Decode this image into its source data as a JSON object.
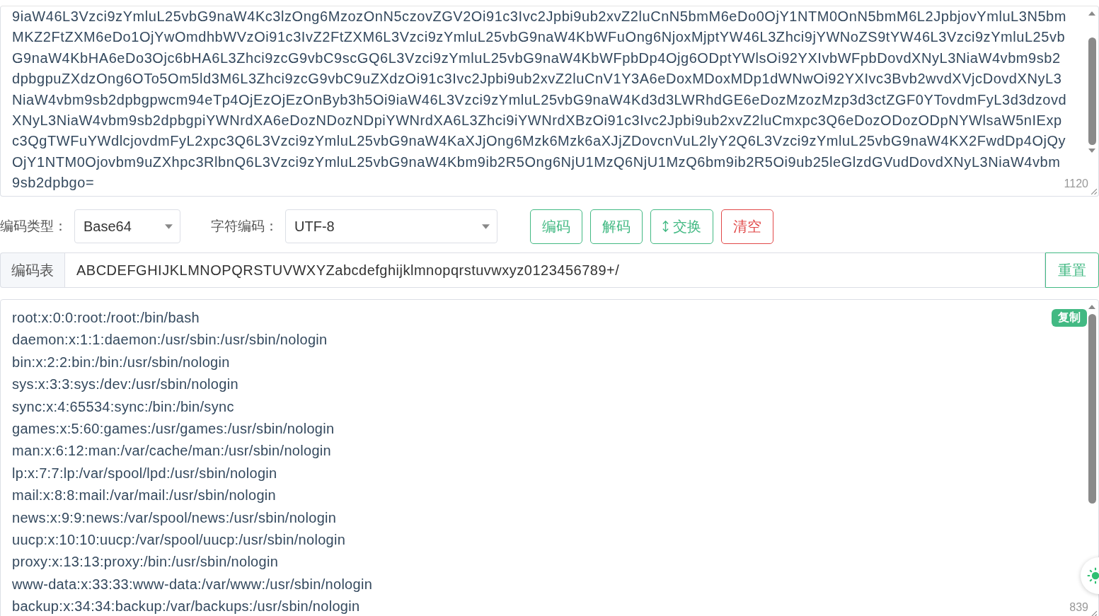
{
  "input": {
    "lines": [
      "9iaW46L3Vzci9zYmluL25vbG9naW4Kc3lzOng6MzozOnN5czovZGV2Oi91c3Ivc2Jpbi9ub2xvZ2luCnN5bmM6eDo0OjY1NTM0OnN5bmM6L2JpbjovYmluL3N5bm",
      "MKZ2FtZXM6eDo1OjYwOmdhbWVzOi91c3IvZ2FtZXM6L3Vzci9zYmluL25vbG9naW4KbWFuOng6NjoxMjptYW46L3Zhci9jYWNoZS9tYW46L3Vzci9zYmluL25vb",
      "G9naW4KbHA6eDo3Ojc6bHA6L3Zhci9zcG9vbC9scGQ6L3Vzci9zYmluL25vbG9naW4KbWFpbDp4Ojg6ODptYWlsOi92YXIvbWFpbDovdXNyL3NiaW4vbm9sb2",
      "dpbgpuZXdzOng6OTo5Om5ld3M6L3Zhci9zcG9vbC9uZXdzOi91c3Ivc2Jpbi9ub2xvZ2luCnV1Y3A6eDoxMDoxMDp1dWNwOi92YXIvc3Bvb2wvdXVjcDovdXNyL3",
      "NiaW4vbm9sb2dpbgpwcm94eTp4OjEzOjEzOnByb3h5Oi9iaW46L3Vzci9zYmluL25vbG9naW4Kd3d3LWRhdGE6eDozMzozMzp3d3ctZGF0YTovdmFyL3d3dzovd",
      "XNyL3NiaW4vbm9sb2dpbgpiYWNrdXA6eDozNDozNDpiYWNrdXA6L3Zhci9iYWNrdXBzOi91c3Ivc2Jpbi9ub2xvZ2luCmxpc3Q6eDozODozODpNYWlsaW5nIExp",
      "c3QgTWFuYWdlcjovdmFyL2xpc3Q6L3Vzci9zYmluL25vbG9naW4KaXJjOng6Mzk6Mzk6aXJjZDovcnVuL2lyY2Q6L3Vzci9zYmluL25vbG9naW4KX2FwdDp4OjQy",
      "OjY1NTM0Ojovbm9uZXhpc3RlbnQ6L3Vzci9zYmluL25vbG9naW4Kbm9ib2R5Ong6NjU1MzQ6NjU1MzQ6bm9ib2R5Oi9ub25leGlzdGVudDovdXNyL3NiaW4vbm",
      "9sb2dpbgo="
    ],
    "count": "1120"
  },
  "controls": {
    "encoding_type": {
      "label": "编码类型：",
      "value": "Base64"
    },
    "charset": {
      "label": "字符编码：",
      "value": "UTF-8"
    },
    "buttons": [
      {
        "label": "编码",
        "kind": "primary"
      },
      {
        "label": "解码",
        "kind": "primary"
      },
      {
        "label": "交换",
        "kind": "swap"
      },
      {
        "label": "清空",
        "kind": "danger"
      }
    ]
  },
  "alphabet": {
    "label": "编码表",
    "value": "ABCDEFGHIJKLMNOPQRSTUVWXYZabcdefghijklmnopqrstuvwxyz0123456789+/",
    "button": "重置"
  },
  "output": {
    "lines": [
      "root:x:0:0:root:/root:/bin/bash",
      "daemon:x:1:1:daemon:/usr/sbin:/usr/sbin/nologin",
      "bin:x:2:2:bin:/bin:/usr/sbin/nologin",
      "sys:x:3:3:sys:/dev:/usr/sbin/nologin",
      "sync:x:4:65534:sync:/bin:/bin/sync",
      "games:x:5:60:games:/usr/games:/usr/sbin/nologin",
      "man:x:6:12:man:/var/cache/man:/usr/sbin/nologin",
      "lp:x:7:7:lp:/var/spool/lpd:/usr/sbin/nologin",
      "mail:x:8:8:mail:/var/mail:/usr/sbin/nologin",
      "news:x:9:9:news:/var/spool/news:/usr/sbin/nologin",
      "uucp:x:10:10:uucp:/var/spool/uucp:/usr/sbin/nologin",
      "proxy:x:13:13:proxy:/bin:/usr/sbin/nologin",
      "www-data:x:33:33:www-data:/var/www:/usr/sbin/nologin",
      "backup:x:34:34:backup:/var/backups:/usr/sbin/nologin"
    ],
    "copy": "复制",
    "count": "839"
  }
}
